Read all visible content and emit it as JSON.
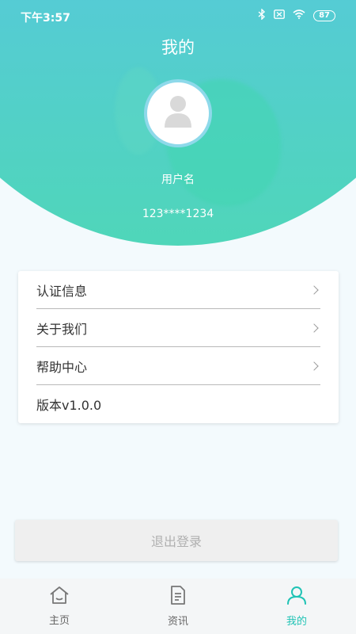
{
  "status_bar": {
    "time": "下午3:57",
    "battery": "87",
    "icons": [
      "bluetooth-icon",
      "no-sim-icon",
      "wifi-icon",
      "battery-icon"
    ]
  },
  "header": {
    "title": "我的",
    "username": "用户名",
    "phone": "123****1234"
  },
  "menu": {
    "items": [
      {
        "label": "认证信息",
        "has_arrow": true
      },
      {
        "label": "关于我们",
        "has_arrow": true
      },
      {
        "label": "帮助中心",
        "has_arrow": true
      },
      {
        "label": "版本v1.0.0",
        "has_arrow": false
      }
    ]
  },
  "logout": {
    "label": "退出登录"
  },
  "tabbar": {
    "tabs": [
      {
        "label": "主页",
        "icon": "home-icon",
        "active": false
      },
      {
        "label": "资讯",
        "icon": "news-icon",
        "active": false
      },
      {
        "label": "我的",
        "icon": "profile-icon",
        "active": true
      }
    ]
  },
  "colors": {
    "accent": "#20c3b5",
    "header_top": "#5bc3e3",
    "header_bottom": "#4fd6b9"
  }
}
